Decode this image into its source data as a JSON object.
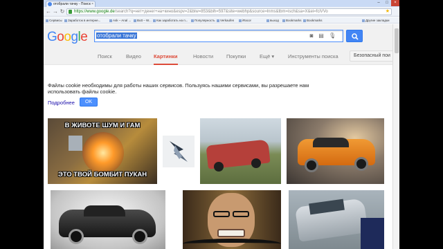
{
  "browser": {
    "tab_title": "отобрали тачку - Поиск",
    "url_host": "https://www.google.de",
    "url_rest": "/search?q=нет+денег+на+кино&espv=2&biw=853&bih=597&site=webhp&source=lnms&tbm=isch&sa=X&ei=fciVVo",
    "bookmarks": [
      "Сервисы",
      "Заработок в интерне...",
      "Ask – Anal ...",
      "Butt – W...",
      "Как заработать на п...",
      "Популярность",
      "Verkaufen",
      "iRacor",
      "выход",
      "Bookmarks",
      "Bookmarks",
      "Другие закладки"
    ]
  },
  "google": {
    "logo": "Google",
    "query": "отобрали тачку",
    "tabs": [
      {
        "label": "Поиск",
        "active": false
      },
      {
        "label": "Видео",
        "active": false
      },
      {
        "label": "Картинки",
        "active": true
      },
      {
        "label": "Новости",
        "active": false
      },
      {
        "label": "Покупки",
        "active": false
      },
      {
        "label": "Ещё ▾",
        "active": false
      },
      {
        "label": "Инструменты поиска",
        "active": false
      }
    ],
    "safe_search": "Безопасный пои"
  },
  "cookie": {
    "text": "Файлы cookie необходимы для работы наших сервисов. Пользуясь нашими сервисами, вы разрешаете нам использовать файлы cookie.",
    "more_link": "Подробнее",
    "ok_button": "OK"
  },
  "images": {
    "meme_top": "В ЖИВОТЕ ШУМ И ГАМ",
    "meme_bottom": "ЭТО ТВОЙ БОМБИТ ПУКАН"
  },
  "colors": {
    "accent_red": "#dd4b39",
    "accent_blue": "#4285f4",
    "link_blue": "#1a0dab"
  }
}
